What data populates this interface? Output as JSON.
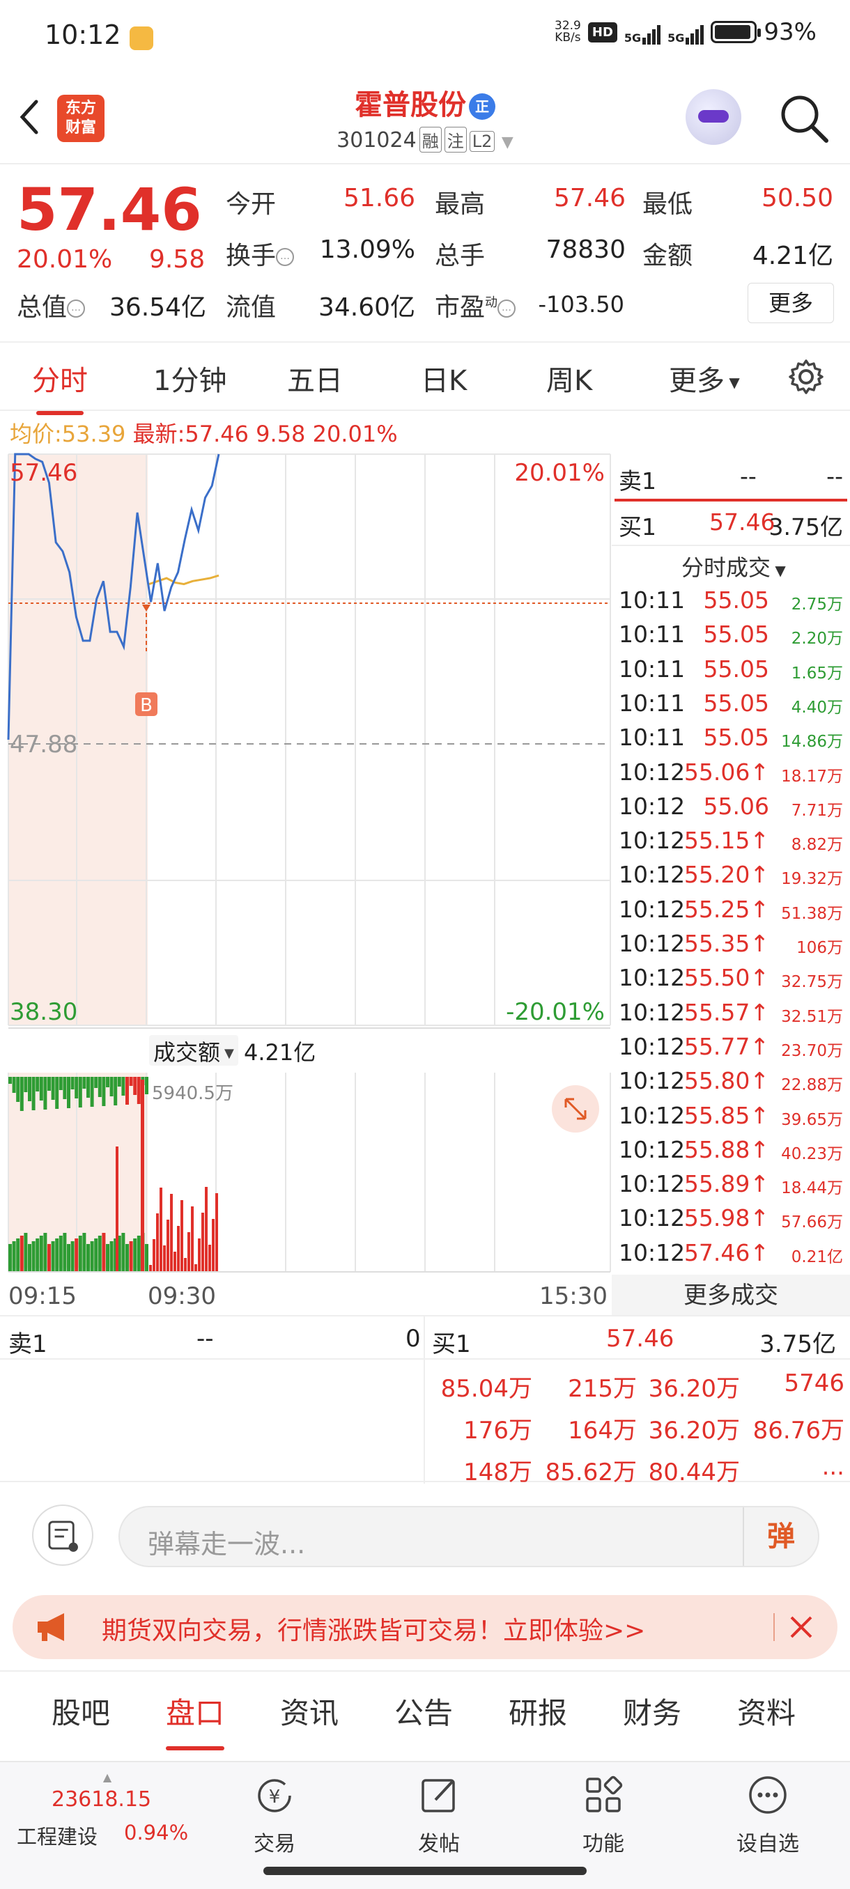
{
  "status_bar": {
    "time": "10:12",
    "net_speed": "32.9",
    "net_unit": "KB/s",
    "hd": "HD",
    "net1": "5G",
    "net2": "5G",
    "battery": "93%",
    "battery_level": 0.93
  },
  "header": {
    "logo_line1": "东方",
    "logo_line2": "财富",
    "name": "霍普股份",
    "name_tag": "正",
    "code": "301024",
    "tags": [
      "融",
      "注",
      "L2"
    ]
  },
  "quote": {
    "price": "57.46",
    "change_pct": "20.01%",
    "change": "9.58",
    "open_label": "今开",
    "open": "51.66",
    "high_label": "最高",
    "high": "57.46",
    "low_label": "最低",
    "low": "50.50",
    "turnover_label": "换手",
    "turnover": "13.09%",
    "volume_label": "总手",
    "volume": "78830",
    "amount_label": "金额",
    "amount": "4.21亿",
    "mktcap_label": "总值",
    "mktcap": "36.54亿",
    "float_label": "流值",
    "float": "34.60亿",
    "pe_label": "市盈",
    "pe_sup": "动",
    "pe": "-103.50",
    "more": "更多"
  },
  "tabs": [
    "分时",
    "1分钟",
    "五日",
    "日K",
    "周K",
    "更多"
  ],
  "chart_info": {
    "avg_label": "均价:",
    "avg": "53.39",
    "latest_label": "最新:",
    "latest": "57.46",
    "change": "9.58",
    "pct": "20.01%"
  },
  "chart_data": {
    "type": "line",
    "y_top": "57.46",
    "y_mid": "47.88",
    "y_bot": "38.30",
    "pct_top": "20.01%",
    "pct_bot": "-20.01%",
    "buy_marker": "B",
    "volume_label": "成交额",
    "volume_total": "4.21亿",
    "volume_peak": "5940.5万",
    "x_labels": [
      "09:15",
      "09:30",
      "15:30"
    ],
    "ylim": [
      38.3,
      57.46
    ],
    "price": [
      47.88,
      57.46,
      57.46,
      57.46,
      57.3,
      57.2,
      56.5,
      54.5,
      54.2,
      53.5,
      52.0,
      51.2,
      51.2,
      52.6,
      53.2,
      51.5,
      51.5,
      51.0,
      53.0,
      55.5,
      54.0,
      52.5,
      53.8,
      52.2,
      53.0,
      53.5,
      54.6,
      55.6,
      54.9,
      56.0,
      56.4,
      57.46
    ],
    "avg": [
      53.1,
      53.2,
      53.3,
      53.15,
      53.1,
      53.2,
      53.25,
      53.3,
      53.39
    ]
  },
  "side": {
    "sell1_label": "卖1",
    "sell1_price": "--",
    "sell1_vol": "--",
    "buy1_label": "买1",
    "buy1_price": "57.46",
    "buy1_vol": "3.75亿",
    "ticks_title": "分时成交",
    "ticks": [
      {
        "t": "10:11",
        "p": "55.05",
        "v": "2.75万",
        "up": false
      },
      {
        "t": "10:11",
        "p": "55.05",
        "v": "2.20万",
        "up": false
      },
      {
        "t": "10:11",
        "p": "55.05",
        "v": "1.65万",
        "up": false
      },
      {
        "t": "10:11",
        "p": "55.05",
        "v": "4.40万",
        "up": false
      },
      {
        "t": "10:11",
        "p": "55.05",
        "v": "14.86万",
        "up": false
      },
      {
        "t": "10:12",
        "p": "55.06↑",
        "v": "18.17万",
        "up": true
      },
      {
        "t": "10:12",
        "p": "55.06",
        "v": "7.71万",
        "up": true
      },
      {
        "t": "10:12",
        "p": "55.15↑",
        "v": "8.82万",
        "up": true
      },
      {
        "t": "10:12",
        "p": "55.20↑",
        "v": "19.32万",
        "up": true
      },
      {
        "t": "10:12",
        "p": "55.25↑",
        "v": "51.38万",
        "up": true
      },
      {
        "t": "10:12",
        "p": "55.35↑",
        "v": "106万",
        "up": true
      },
      {
        "t": "10:12",
        "p": "55.50↑",
        "v": "32.75万",
        "up": true
      },
      {
        "t": "10:12",
        "p": "55.57↑",
        "v": "32.51万",
        "up": true
      },
      {
        "t": "10:12",
        "p": "55.77↑",
        "v": "23.70万",
        "up": true
      },
      {
        "t": "10:12",
        "p": "55.80↑",
        "v": "22.88万",
        "up": true
      },
      {
        "t": "10:12",
        "p": "55.85↑",
        "v": "39.65万",
        "up": true
      },
      {
        "t": "10:12",
        "p": "55.88↑",
        "v": "40.23万",
        "up": true
      },
      {
        "t": "10:12",
        "p": "55.89↑",
        "v": "18.44万",
        "up": true
      },
      {
        "t": "10:12",
        "p": "55.98↑",
        "v": "57.66万",
        "up": true
      },
      {
        "t": "10:12",
        "p": "57.46↑",
        "v": "0.21亿",
        "up": true
      }
    ],
    "more_ticks": "更多成交"
  },
  "book": {
    "sell_label": "卖1",
    "sell_price": "--",
    "sell_vol": "0",
    "buy_label": "买1",
    "buy_price": "57.46",
    "buy_vol": "3.75亿",
    "rows": [
      [
        "85.04万",
        "215万",
        "36.20万",
        "5746"
      ],
      [
        "176万",
        "164万",
        "36.20万",
        "86.76万"
      ],
      [
        "148万",
        "85.62万",
        "80.44万",
        "..."
      ]
    ]
  },
  "danmu": {
    "placeholder": "弹幕走一波...",
    "send": "弹"
  },
  "banner": {
    "text": "期货双向交易，行情涨跌皆可交易！立即体验>>"
  },
  "subtabs": [
    "股吧",
    "盘口",
    "资讯",
    "公告",
    "研报",
    "财务",
    "资料"
  ],
  "bottom_nav": {
    "index_value": "23618.15",
    "index_name": "工程建设",
    "index_pct": "0.94%",
    "items": [
      "交易",
      "发帖",
      "功能",
      "设自选"
    ]
  },
  "colors": {
    "up": "#e0302a",
    "down": "#2e9c34",
    "line": "#3b6fc9",
    "avg": "#e8b03a"
  }
}
